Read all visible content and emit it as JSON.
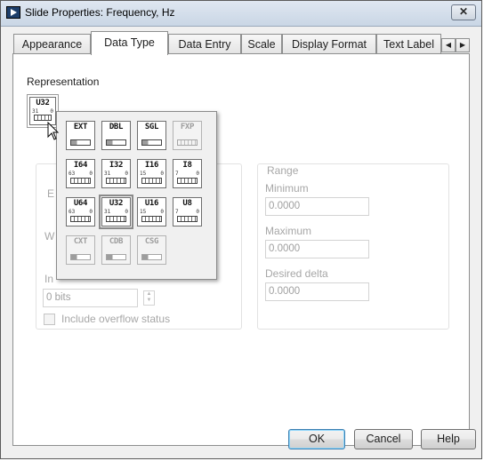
{
  "window": {
    "title": "Slide Properties: Frequency, Hz",
    "close_label": "✕"
  },
  "tabs": [
    {
      "label": "Appearance",
      "active": false
    },
    {
      "label": "Data Type",
      "active": true
    },
    {
      "label": "Data Entry",
      "active": false
    },
    {
      "label": "Scale",
      "active": false
    },
    {
      "label": "Display Format",
      "active": false
    },
    {
      "label": "Text Label",
      "active": false
    }
  ],
  "tab_scroll": {
    "left": "◀",
    "right": "▶"
  },
  "representation": {
    "label": "Representation",
    "current": "U32",
    "bits_high": "31",
    "bits_low": "0"
  },
  "encoding": {
    "partial_label_1": "E",
    "partial_label_2": "W",
    "partial_label_3": "In",
    "bits_value": "0 bits"
  },
  "range": {
    "title": "Range",
    "minimum_label": "Minimum",
    "minimum_value": "0.0000",
    "maximum_label": "Maximum",
    "maximum_value": "0.0000",
    "delta_label": "Desired delta",
    "delta_value": "0.0000"
  },
  "overflow": {
    "label": "Include overflow status",
    "checked": false
  },
  "palette": {
    "rows": [
      [
        {
          "code": "EXT",
          "kind": "float",
          "enabled": true,
          "selected": false,
          "hi": "",
          "lo": ""
        },
        {
          "code": "DBL",
          "kind": "float",
          "enabled": true,
          "selected": false,
          "hi": "",
          "lo": ""
        },
        {
          "code": "SGL",
          "kind": "float",
          "enabled": true,
          "selected": false,
          "hi": "",
          "lo": ""
        },
        {
          "code": "FXP",
          "kind": "fixed",
          "enabled": false,
          "selected": false,
          "hi": "",
          "lo": ""
        }
      ],
      [
        {
          "code": "I64",
          "kind": "int",
          "enabled": true,
          "selected": false,
          "hi": "63",
          "lo": "0"
        },
        {
          "code": "I32",
          "kind": "int",
          "enabled": true,
          "selected": false,
          "hi": "31",
          "lo": "0"
        },
        {
          "code": "I16",
          "kind": "int",
          "enabled": true,
          "selected": false,
          "hi": "15",
          "lo": "0"
        },
        {
          "code": "I8",
          "kind": "int",
          "enabled": true,
          "selected": false,
          "hi": "7",
          "lo": "0"
        }
      ],
      [
        {
          "code": "U64",
          "kind": "int",
          "enabled": true,
          "selected": false,
          "hi": "63",
          "lo": "0"
        },
        {
          "code": "U32",
          "kind": "int",
          "enabled": true,
          "selected": true,
          "hi": "31",
          "lo": "0"
        },
        {
          "code": "U16",
          "kind": "int",
          "enabled": true,
          "selected": false,
          "hi": "15",
          "lo": "0"
        },
        {
          "code": "U8",
          "kind": "int",
          "enabled": true,
          "selected": false,
          "hi": "7",
          "lo": "0"
        }
      ],
      [
        {
          "code": "CXT",
          "kind": "complex",
          "enabled": false,
          "selected": false,
          "hi": "",
          "lo": ""
        },
        {
          "code": "CDB",
          "kind": "complex",
          "enabled": false,
          "selected": false,
          "hi": "",
          "lo": ""
        },
        {
          "code": "CSG",
          "kind": "complex",
          "enabled": false,
          "selected": false,
          "hi": "",
          "lo": ""
        }
      ]
    ]
  },
  "buttons": {
    "ok": "OK",
    "cancel": "Cancel",
    "help": "Help"
  },
  "icons": [
    "labview-app-icon",
    "close-icon",
    "scroll-left-icon",
    "scroll-right-icon",
    "mouse-pointer-icon",
    "spinner-icon",
    "checkbox-icon"
  ],
  "colors": {
    "window_border": "#5b5b5b",
    "panel_bg": "#ffffff",
    "dialog_bg": "#f0f0f0",
    "disabled_text": "#a7a7a7",
    "default_button_border": "#3c7fb1"
  }
}
